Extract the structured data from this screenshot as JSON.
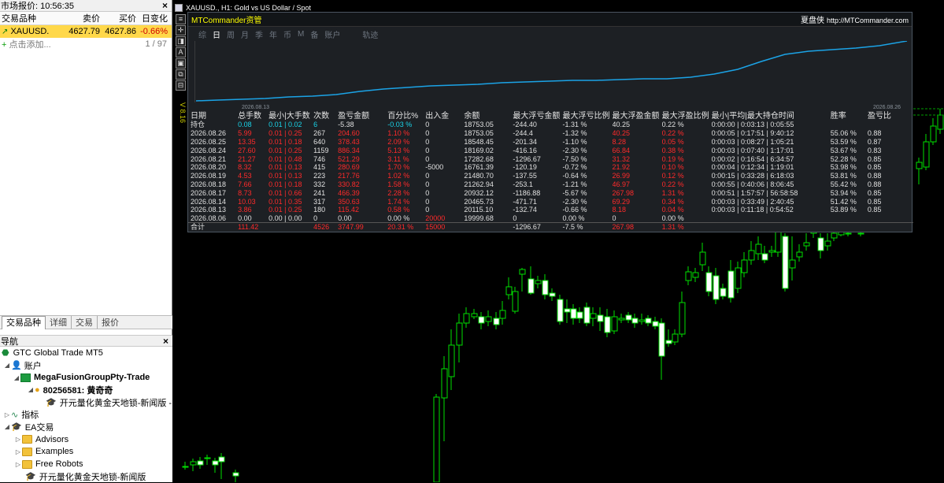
{
  "market_watch": {
    "title": "市场报价: 10:56:35",
    "columns": [
      "交易品种",
      "卖价",
      "买价",
      "日变化"
    ],
    "row": {
      "symbol": "XAUUSD.",
      "bid": "4627.79",
      "ask": "4627.86",
      "change": "-0.66%"
    },
    "add_label": "点击添加...",
    "count": "1 / 97",
    "tabs": [
      "交易品种",
      "详细",
      "交易",
      "报价"
    ]
  },
  "navigator": {
    "title": "导航",
    "root": "GTC Global Trade MT5",
    "accounts": "账户",
    "account_company": "MegaFusionGroupPty-Trade",
    "account_login": "80256581: 黄奇奇",
    "account_ea": "开元量化黄金天地锁-新闻版 - X",
    "indicators": "指标",
    "ea": "EA交易",
    "folders": [
      "Advisors",
      "Examples",
      "Free Robots"
    ],
    "ea_item": "开元量化黄金天地锁-新闻版"
  },
  "chart": {
    "title": "XAUUSD., H1:  Gold vs US Dollar / Spot",
    "vertical_label": "V 8.16",
    "toolbar_icons": [
      "menu-icon",
      "crosshair-icon",
      "shape-icon",
      "text-icon",
      "period-icon",
      "template-icon",
      "window-icon"
    ]
  },
  "mt_panel": {
    "brand": "MTCommander资管",
    "brand_right": "夏盘侠",
    "site": "http://MTCommander.com",
    "periods": [
      "综",
      "日",
      "周",
      "月",
      "季",
      "年",
      "币",
      "M",
      "备",
      "账户"
    ],
    "selected_period": "日",
    "track_label": "轨迹",
    "date_start": "2026.08.13",
    "date_end": "2026.08.26",
    "columns": [
      "日期",
      "总手数",
      "最小|大手数",
      "次数",
      "盈亏金额",
      "百分比%",
      "出入金",
      "余额",
      "最大浮亏金额",
      "最大浮亏比例",
      "最大浮盈金额",
      "最大浮盈比例",
      "最小|平均|最大持仓时间",
      "胜率",
      "盈亏比"
    ],
    "rows": [
      {
        "kind": "pos",
        "cells": [
          "持仓",
          "0.08",
          "0.01 | 0.02",
          "6",
          "-5.38",
          "-0.03 %",
          "0",
          "18753.05",
          "-244.40",
          "-1.31 %",
          "40.25",
          "0.22 %",
          "0:00:00 | 0:03:13 | 0:05:55",
          "",
          ""
        ]
      },
      {
        "kind": "red",
        "cells": [
          "2026.08.26",
          "5.99",
          "0.01 | 0.25",
          "267",
          "204.60",
          "1.10 %",
          "0",
          "18753.05",
          "-244.4",
          "-1.32 %",
          "40.25",
          "0.22 %",
          "0:00:05 | 0:17:51 | 9:40:12",
          "55.06 %",
          "0.88"
        ]
      },
      {
        "kind": "red",
        "cells": [
          "2026.08.25",
          "13.35",
          "0.01 | 0.18",
          "640",
          "378.43",
          "2.09 %",
          "0",
          "18548.45",
          "-201.34",
          "-1.10 %",
          "8.28",
          "0.05 %",
          "0:00:03 | 0:08:27 | 1:05:21",
          "53.59 %",
          "0.87"
        ]
      },
      {
        "kind": "red",
        "cells": [
          "2026.08.24",
          "27.60",
          "0.01 | 0.25",
          "1159",
          "886.34",
          "5.13 %",
          "0",
          "18169.02",
          "-416.16",
          "-2.30 %",
          "66.84",
          "0.38 %",
          "0:00:03 | 0:07:40 | 1:17:01",
          "53.67 %",
          "0.83"
        ]
      },
      {
        "kind": "red",
        "cells": [
          "2026.08.21",
          "21.27",
          "0.01 | 0.48",
          "746",
          "521.29",
          "3.11 %",
          "0",
          "17282.68",
          "-1296.67",
          "-7.50 %",
          "31.32",
          "0.19 %",
          "0:00:02 | 0:16:54 | 6:34:57",
          "52.28 %",
          "0.85"
        ]
      },
      {
        "kind": "red",
        "cells": [
          "2026.08.20",
          "8.32",
          "0.01 | 0.13",
          "415",
          "280.69",
          "1.70 %",
          "-5000",
          "16761.39",
          "-120.19",
          "-0.72 %",
          "21.92",
          "0.10 %",
          "0:00:04 | 0:12:34 | 1:19:01",
          "53.98 %",
          "0.85"
        ]
      },
      {
        "kind": "red",
        "cells": [
          "2026.08.19",
          "4.53",
          "0.01 | 0.13",
          "223",
          "217.76",
          "1.02 %",
          "0",
          "21480.70",
          "-137.55",
          "-0.64 %",
          "26.99",
          "0.12 %",
          "0:00:15 | 0:33:28 | 6:18:03",
          "53.81 %",
          "0.88"
        ]
      },
      {
        "kind": "red",
        "cells": [
          "2026.08.18",
          "7.66",
          "0.01 | 0.18",
          "332",
          "330.82",
          "1.58 %",
          "0",
          "21262.94",
          "-253.1",
          "-1.21 %",
          "46.97",
          "0.22 %",
          "0:00:55 | 0:40:06 | 8:06:45",
          "55.42 %",
          "0.88"
        ]
      },
      {
        "kind": "red",
        "cells": [
          "2026.08.17",
          "8.73",
          "0.01 | 0.66",
          "241",
          "466.39",
          "2.28 %",
          "0",
          "20932.12",
          "-1186.88",
          "-5.67 %",
          "267.98",
          "1.31 %",
          "0:00:51 | 1:57:57 | 56:58:58",
          "53.94 %",
          "0.85"
        ]
      },
      {
        "kind": "red",
        "cells": [
          "2026.08.14",
          "10.03",
          "0.01 | 0.35",
          "317",
          "350.63",
          "1.74 %",
          "0",
          "20465.73",
          "-471.71",
          "-2.30 %",
          "69.29",
          "0.34 %",
          "0:00:03 | 0:33:49 | 2:40:45",
          "51.42 %",
          "0.85"
        ]
      },
      {
        "kind": "red",
        "cells": [
          "2026.08.13",
          "3.86",
          "0.01 | 0.25",
          "180",
          "115.42",
          "0.58 %",
          "0",
          "20115.10",
          "-132.74",
          "-0.66 %",
          "8.18",
          "0.04 %",
          "0:00:03 | 0:11:18 | 0:54:52",
          "53.89 %",
          "0.85"
        ]
      },
      {
        "kind": "neutral",
        "cells": [
          "2026.08.06",
          "0.00",
          "0.00 | 0.00",
          "0",
          "0.00",
          "0.00 %",
          "20000",
          "19999.68",
          "0",
          "0.00 %",
          "0",
          "0.00 %",
          "",
          "",
          ""
        ]
      },
      {
        "kind": "sum",
        "cells": [
          "合计",
          "111.42",
          "",
          "4526",
          "3747.99",
          "20.31 %",
          "15000",
          "",
          "-1296.67",
          "-7.5 %",
          "267.98",
          "1.31 %",
          "",
          "",
          ""
        ]
      }
    ]
  },
  "colors": {
    "bull": "#00e000",
    "bear": "#ffffff",
    "balance_line": "#1ba3e6",
    "accent": "#ffff00"
  }
}
